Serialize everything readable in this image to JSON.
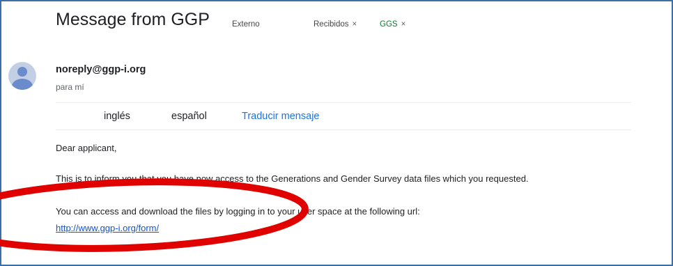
{
  "email": {
    "subject": "Message from GGP",
    "labels": {
      "externo": "Externo",
      "recibidos": "Recibidos",
      "ggs": "GGS",
      "remove_symbol": "×"
    },
    "sender": "noreply@ggp-i.org",
    "recipient": "para mí",
    "translate": {
      "from_lang": "inglés",
      "to_lang": "español",
      "action": "Traducir mensaje"
    },
    "body": {
      "greeting": "Dear applicant,",
      "paragraph1": "This is to inform you that you have now access to the Generations and Gender Survey data files which you requested.",
      "paragraph2": "You can access and download the files by logging in to your user space at the following url:",
      "link": "http://www.ggp-i.org/form/"
    }
  },
  "colors": {
    "frame_border": "#3c6fa8",
    "highlight": "#e00000",
    "link": "#1155cc",
    "ggs_label": "#137333",
    "avatar": "#6a8ccc"
  }
}
